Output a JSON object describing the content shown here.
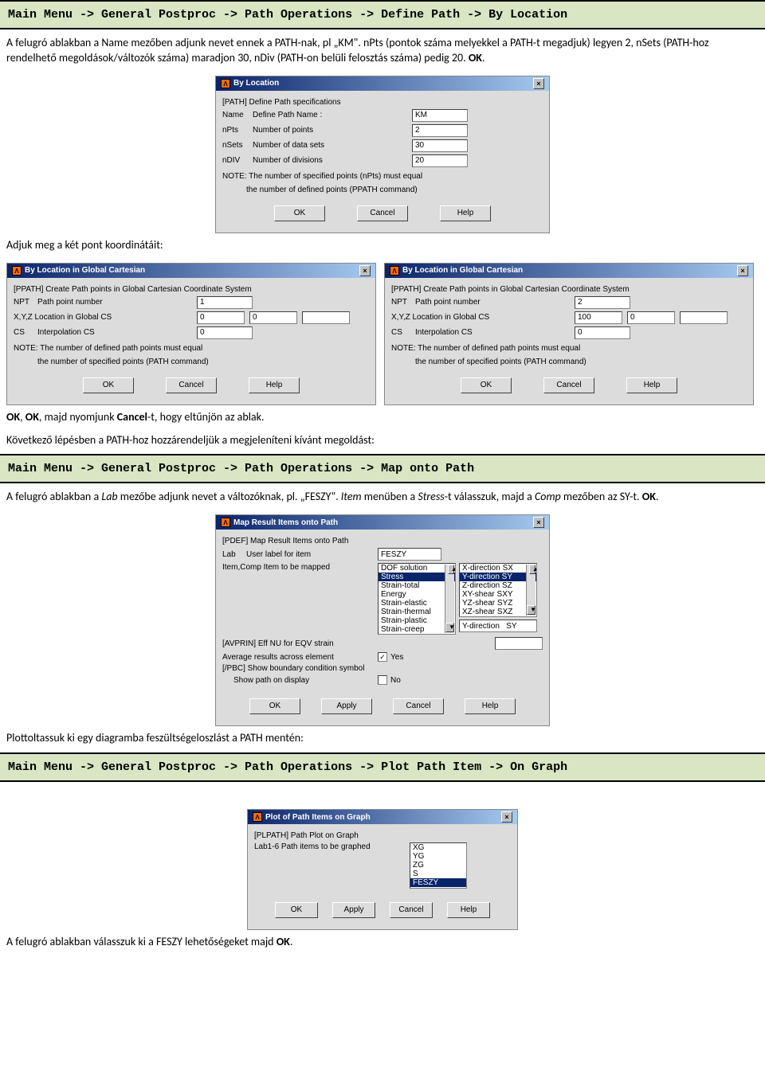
{
  "menu1": "Main Menu -> General Postproc -> Path Operations -> Define Path -> By Location",
  "p1": "A felugró ablakban a Name mezőben adjunk nevet ennek a PATH-nak, pl „KM\". nPts (pontok száma melyekkel a PATH-t megadjuk) legyen 2, nSets (PATH-hoz rendelhető megoldások/változók száma) maradjon 30, nDiv (PATH-on belüli felosztás száma) pedig 20. ",
  "p1b": "OK",
  "dlg1": {
    "title": "By Location",
    "hdr": "[PATH]  Define Path specifications",
    "r1a": "Name",
    "r1b": "Define Path Name :",
    "v1": "KM",
    "r2a": "nPts",
    "r2b": "Number of points",
    "v2": "2",
    "r3a": "nSets",
    "r3b": "Number of data sets",
    "v3": "30",
    "r4a": "nDIV",
    "r4b": "Number of divisions",
    "v4": "20",
    "n1": "NOTE: The number of specified points (nPts) must equal",
    "n2": "the number of defined points (PPATH command)",
    "ok": "OK",
    "cancel": "Cancel",
    "help": "Help"
  },
  "p2": "Adjuk meg a két pont koordinátáit:",
  "dlg2": {
    "title": "By Location in Global Cartesian",
    "hdr": "[PPATH]  Create Path points in Global Cartesian Coordinate System",
    "r1a": "NPT",
    "r1b": "Path point number",
    "r2": "X,Y,Z  Location in Global CS",
    "r3a": "CS",
    "r3b": "Interpolation CS",
    "n1": "NOTE: The number of defined path points must equal",
    "n2": "the number of specified points (PATH command)",
    "ok": "OK",
    "cancel": "Cancel",
    "help": "Help",
    "L": {
      "npt": "1",
      "x": "0",
      "y": "0",
      "z": "",
      "cs": "0"
    },
    "R": {
      "npt": "2",
      "x": "100",
      "y": "0",
      "z": "",
      "cs": "0"
    }
  },
  "p3a": "OK",
  "p3b": ", ",
  "p3c": "OK",
  "p3d": ", majd nyomjunk ",
  "p3e": "Cancel",
  "p3f": "-t, hogy eltűnjön az ablak.",
  "p4": "Következő lépésben a PATH-hoz hozzárendeljük a megjeleníteni kívánt megoldást:",
  "menu2": "Main Menu -> General Postproc -> Path Operations -> Map onto Path",
  "p5a": "A felugró ablakban a ",
  "p5b": "Lab",
  "p5c": " mezőbe adjunk nevet a változóknak, pl. „FESZY\". ",
  "p5d": "Item",
  "p5e": " menüben a ",
  "p5f": "Stress",
  "p5g": "-t válasszuk, majd a ",
  "p5h": "Comp",
  "p5i": " mezőben az SY-t. ",
  "p5j": "OK",
  "dlg3": {
    "title": "Map Result Items onto Path",
    "hdr": "[PDEF]  Map Result Items onto Path",
    "r1a": "Lab",
    "r1b": "User label for item",
    "v1": "FESZY",
    "r2": "Item,Comp  Item to be mapped",
    "list1": [
      "DOF solution",
      "Stress",
      "Strain-total",
      "Energy",
      "Strain-elastic",
      "Strain-thermal",
      "Strain-plastic",
      "Strain-creep"
    ],
    "list1sel": "Stress",
    "list2": [
      "X-direction   SX",
      "Y-direction   SY",
      "Z-direction   SZ",
      "XY-shear     SXY",
      "YZ-shear     SYZ",
      "XZ-shear     SXZ"
    ],
    "list2sel": "Y-direction   SY",
    "selbox": "Y-direction   SY",
    "r3": "[AVPRIN]  Eff NU for EQV strain",
    "r4": "Average results across element",
    "cb1": "✓",
    "cb1l": "Yes",
    "r5": "[/PBC]  Show boundary condition symbol",
    "r6": "Show path on display",
    "cb2": "",
    "cb2l": "No",
    "ok": "OK",
    "apply": "Apply",
    "cancel": "Cancel",
    "help": "Help"
  },
  "p6": "Plottoltassuk ki egy diagramba feszültségeloszlást a PATH mentén:",
  "menu3": "Main Menu -> General Postproc -> Path Operations -> Plot Path Item -> On Graph",
  "dlg4": {
    "title": "Plot of Path Items on Graph",
    "hdr": "[PLPATH]  Path Plot on Graph",
    "r1": "Lab1-6  Path items to be graphed",
    "list": [
      "XG",
      "YG",
      "ZG",
      "S",
      "FESZY"
    ],
    "sel": "FESZY",
    "ok": "OK",
    "apply": "Apply",
    "cancel": "Cancel",
    "help": "Help"
  },
  "p7a": "A felugró ablakban válasszuk ki a FESZY lehetőségeket majd ",
  "p7b": "OK",
  "p7c": "."
}
